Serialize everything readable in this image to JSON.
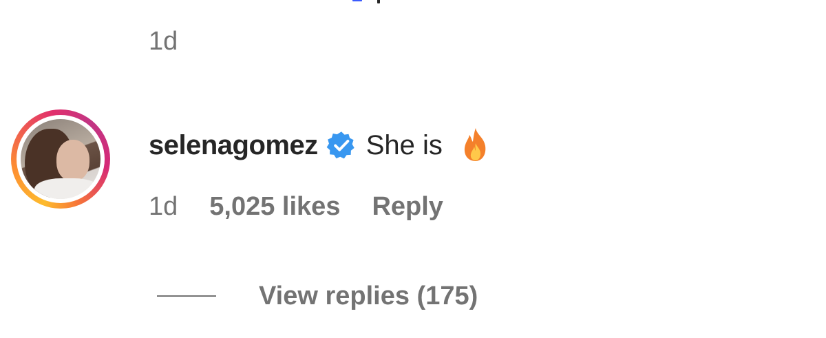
{
  "previous_comment": {
    "time": "1d"
  },
  "comment": {
    "username": "selenagomez",
    "verified": true,
    "text": "She is",
    "emoji": "fire-emoji",
    "time": "1d",
    "likes": "5,025 likes",
    "reply_label": "Reply",
    "view_replies_label": "View replies (175)"
  },
  "colors": {
    "text_primary": "#262626",
    "text_secondary": "#737373",
    "verified_blue": "#3897f0",
    "fire_orange": "#f4802b"
  }
}
